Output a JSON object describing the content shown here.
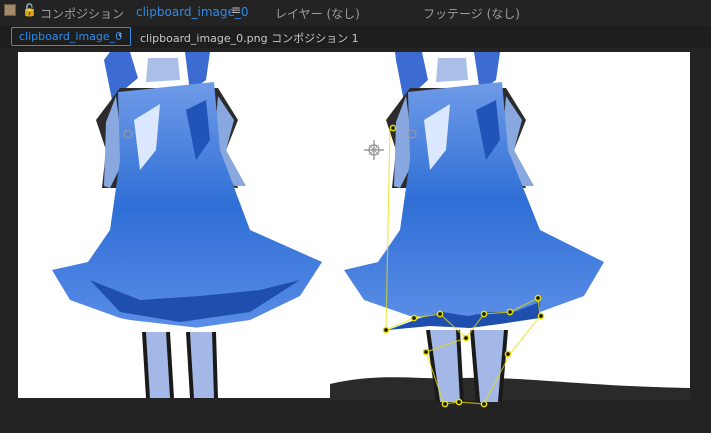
{
  "header": {
    "composition_prefix": "コンポジション",
    "composition_name": "clipboard_image_0",
    "layer_label": "レイヤー (なし)",
    "footage_label": "フッテージ (なし)"
  },
  "tabs": {
    "active_tab": "clipboard_image_0",
    "breadcrumb": "clipboard_image_0.png コンポジション 1"
  },
  "colors": {
    "accent": "#2d8ceb",
    "panel_bg": "#232323",
    "mask_point": "#e8e000"
  },
  "icons": [
    "square-swatch-icon",
    "lock-icon",
    "hamburger-menu-icon",
    "chevron-left-icon",
    "anchor-point-icon"
  ]
}
